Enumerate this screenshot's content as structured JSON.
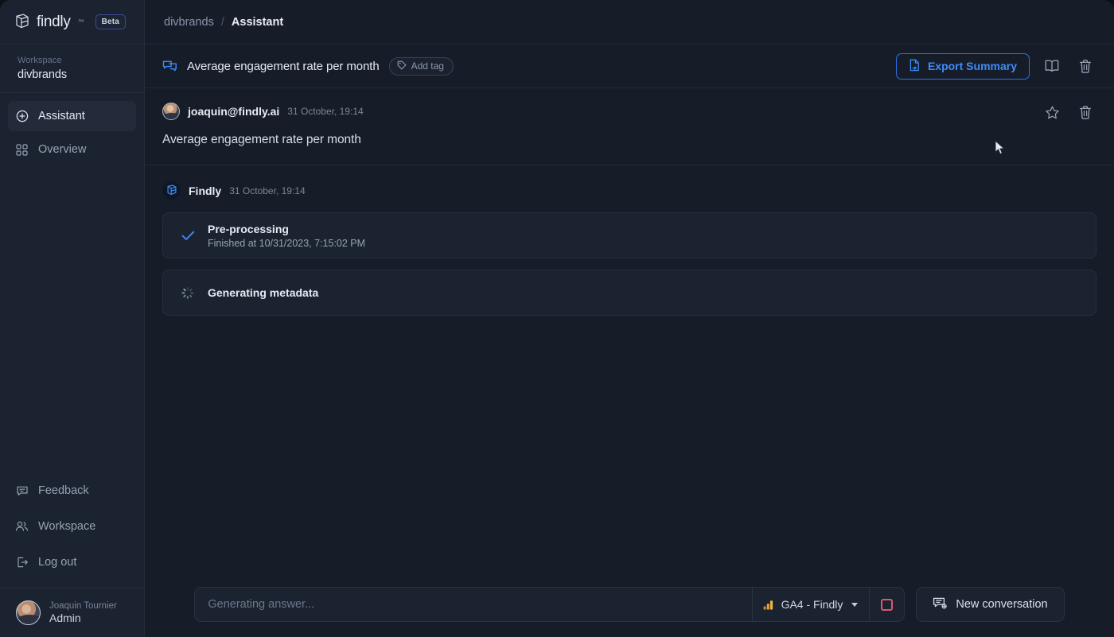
{
  "brand": {
    "name": "findly",
    "trademark": "™",
    "badge": "Beta",
    "logo_icon": "findly-logo-icon",
    "accent_blue": "#3e8bfb",
    "accent_red": "#e2566f",
    "accent_orange": "#e8a33d"
  },
  "sidebar": {
    "workspace_label": "Workspace",
    "workspace_name": "divbrands",
    "nav": [
      {
        "label": "Assistant",
        "icon": "plus-circle-icon",
        "active": true
      },
      {
        "label": "Overview",
        "icon": "grid-dots-icon",
        "active": false
      }
    ],
    "bottom_nav": [
      {
        "label": "Feedback",
        "icon": "feedback-message-icon"
      },
      {
        "label": "Workspace",
        "icon": "users-icon"
      },
      {
        "label": "Log out",
        "icon": "logout-icon"
      }
    ],
    "user": {
      "name": "Joaquin Tournier",
      "role": "Admin",
      "avatar_icon": "user-avatar"
    }
  },
  "breadcrumb": {
    "root": "divbrands",
    "separator": "/",
    "current": "Assistant"
  },
  "conversation_header": {
    "icon": "conversation-icon",
    "title": "Average engagement rate per month",
    "add_tag_label": "Add tag",
    "add_tag_icon": "tag-icon",
    "export_label": "Export Summary",
    "export_icon": "export-file-icon",
    "book_icon": "book-icon",
    "delete_icon": "trash-icon"
  },
  "messages": {
    "user": {
      "author": "joaquin@findly.ai",
      "timestamp": "31 October, 19:14",
      "text": "Average engagement rate per month",
      "star_icon": "star-icon",
      "delete_icon": "trash-icon"
    },
    "assistant": {
      "author": "Findly",
      "timestamp": "31 October, 19:14",
      "steps": [
        {
          "status": "done",
          "status_icon": "check-icon",
          "title": "Pre-processing",
          "subtitle": "Finished at 10/31/2023, 7:15:02 PM"
        },
        {
          "status": "running",
          "status_icon": "spinner-icon",
          "title": "Generating metadata",
          "subtitle": ""
        }
      ]
    }
  },
  "composer": {
    "placeholder": "Generating answer...",
    "value": "",
    "source": {
      "label": "GA4 - Findly",
      "icon": "ga4-bars-icon",
      "caret_icon": "chevron-down-icon"
    },
    "stop_button": {
      "label": "",
      "icon": "stop-square-icon"
    },
    "new_conversation": {
      "label": "New conversation",
      "icon": "new-chat-icon"
    }
  }
}
